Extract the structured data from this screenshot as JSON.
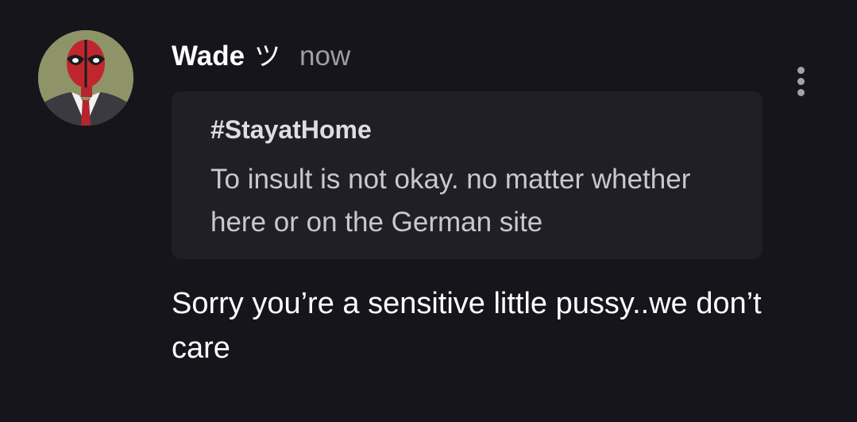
{
  "post": {
    "author": {
      "name": "Wade",
      "symbol": "ツ",
      "avatar_icon": "deadpool-avatar"
    },
    "timestamp": "now",
    "menu_icon": "more-vertical-icon",
    "quote": {
      "title": "#StayatHome",
      "text": "To insult is not okay. no matter whether here or on the German site"
    },
    "message": "Sorry you’re a sensitive little pussy..we don’t care"
  },
  "colors": {
    "background": "#16151b",
    "quote_background": "#201f27",
    "timestamp": "#9f9ea6",
    "avatar_background": "#8f9368"
  }
}
